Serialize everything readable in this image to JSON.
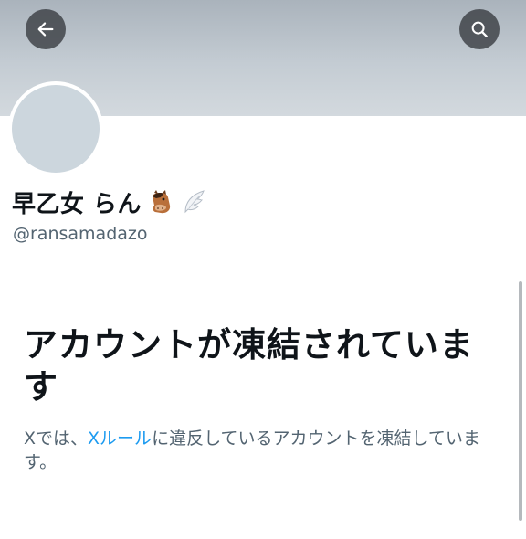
{
  "header": {
    "back_icon": "arrow-left-icon",
    "search_icon": "search-icon"
  },
  "profile": {
    "display_name": "早乙女 らん",
    "emojis": [
      "horse-face-emoji",
      "wing-emoji"
    ],
    "handle": "@ransamadazo"
  },
  "suspension": {
    "title": "アカウントが凍結されています",
    "desc_prefix": "Xでは、",
    "rules_link": "Xルール",
    "desc_suffix": "に違反しているアカウントを凍結しています。"
  },
  "colors": {
    "banner": "#c4ccd3",
    "avatar": "#ccd6dd",
    "link": "#1d9bf0",
    "secondary_text": "#536471",
    "primary_text": "#0f1419"
  }
}
